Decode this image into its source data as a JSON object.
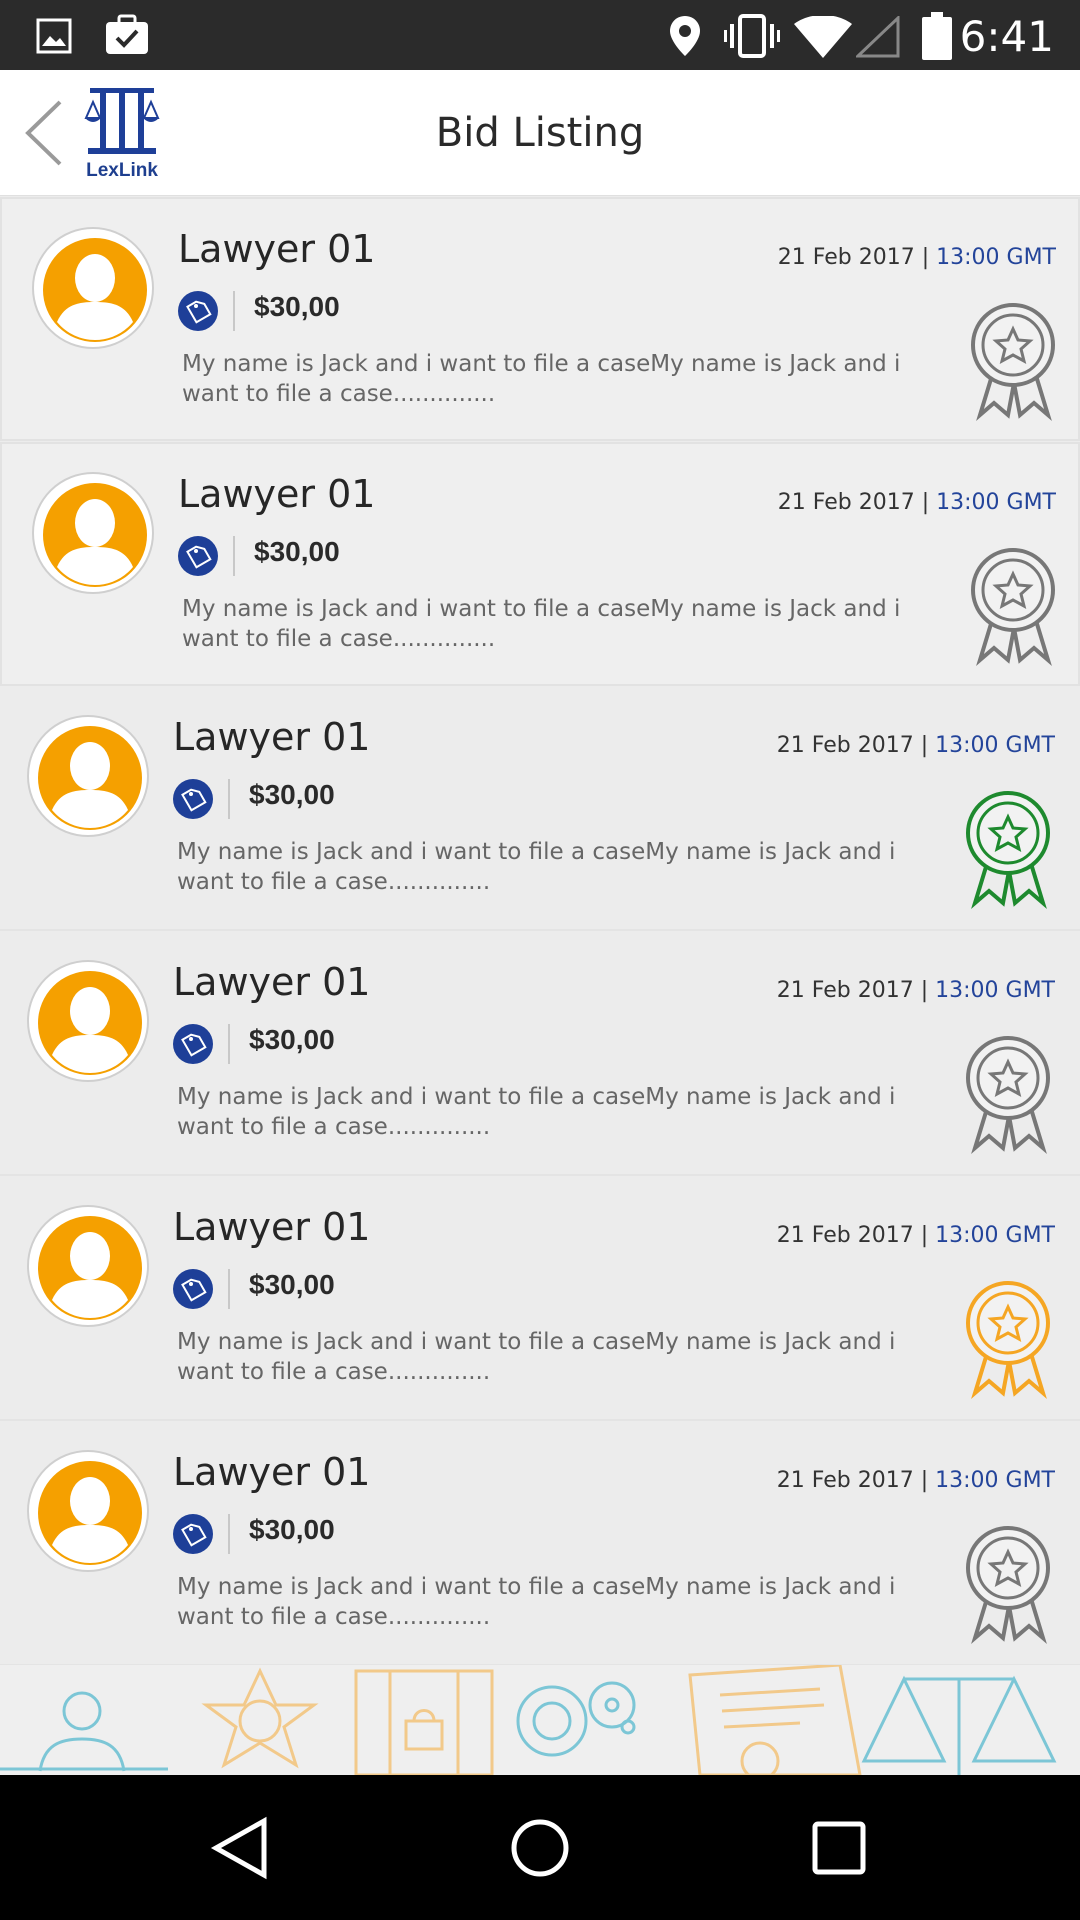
{
  "status_bar": {
    "time": "6:41",
    "icons": [
      "image-icon",
      "briefcase-check-icon",
      "location-icon",
      "vibrate-icon",
      "wifi-icon",
      "signal-icon",
      "battery-icon"
    ]
  },
  "header": {
    "title": "Bid Listing",
    "logo_text": "LexLink",
    "back_icon": "chevron-left-icon"
  },
  "colors": {
    "brand_blue": "#1e3f98",
    "avatar_orange": "#f5a000",
    "award_grey": "#777777",
    "award_green": "#1e8a2e",
    "award_gold": "#f5a623"
  },
  "bids": [
    {
      "name": "Lawyer 01",
      "date": "21 Feb 2017",
      "separator": "|",
      "time": "13:00 GMT",
      "price": "$30,00",
      "description": "My name is Jack and i want to file a caseMy name is Jack and i want to file a case..............",
      "award": "grey"
    },
    {
      "name": "Lawyer 01",
      "date": "21 Feb 2017",
      "separator": "|",
      "time": "13:00 GMT",
      "price": "$30,00",
      "description": "My name is Jack and i want to file a caseMy name is Jack and i want to file a case..............",
      "award": "grey"
    },
    {
      "name": "Lawyer 01",
      "date": "21 Feb 2017",
      "separator": "|",
      "time": "13:00 GMT",
      "price": "$30,00",
      "description": "My name is Jack and i want to file a caseMy name is Jack and i want to file a case..............",
      "award": "green"
    },
    {
      "name": "Lawyer 01",
      "date": "21 Feb 2017",
      "separator": "|",
      "time": "13:00 GMT",
      "price": "$30,00",
      "description": "My name is Jack and i want to file a caseMy name is Jack and i want to file a case..............",
      "award": "grey"
    },
    {
      "name": "Lawyer 01",
      "date": "21 Feb 2017",
      "separator": "|",
      "time": "13:00 GMT",
      "price": "$30,00",
      "description": "My name is Jack and i want to file a caseMy name is Jack and i want to file a case..............",
      "award": "gold"
    },
    {
      "name": "Lawyer 01",
      "date": "21 Feb 2017",
      "separator": "|",
      "time": "13:00 GMT",
      "price": "$30,00",
      "description": "My name is Jack and i want to file a caseMy name is Jack and i want to file a case..............",
      "award": "grey"
    }
  ],
  "nav_bar": {
    "buttons": [
      "back-triangle-icon",
      "home-circle-icon",
      "recents-square-icon"
    ]
  }
}
